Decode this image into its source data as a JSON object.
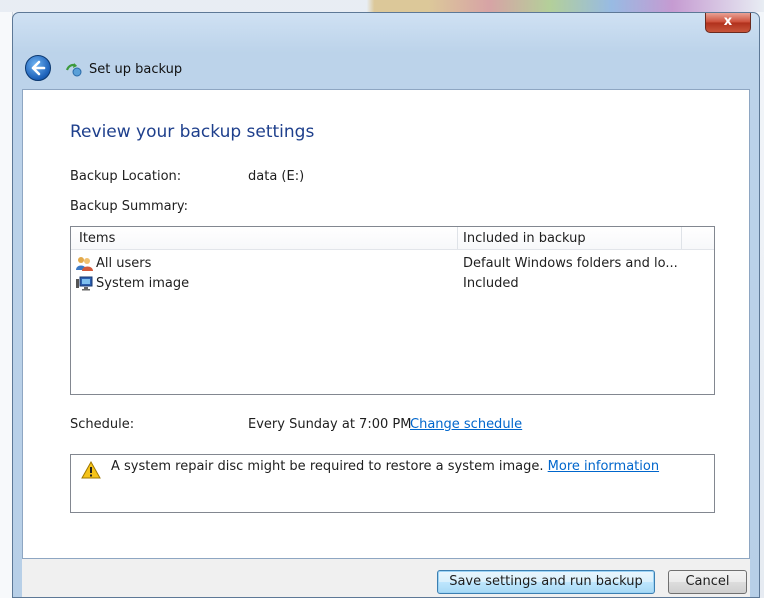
{
  "window": {
    "title": "Set up backup",
    "close_glyph": "x"
  },
  "page": {
    "heading": "Review your backup settings"
  },
  "summary": {
    "location_label": "Backup Location:",
    "location_value": "data (E:)",
    "summary_label": "Backup Summary:"
  },
  "table": {
    "columns": [
      "Items",
      "Included in backup"
    ],
    "rows": [
      {
        "item": "All users",
        "included": "Default Windows folders and lo...",
        "icon": "users-icon"
      },
      {
        "item": "System image",
        "included": "Included",
        "icon": "system-image-icon"
      }
    ]
  },
  "schedule": {
    "label": "Schedule:",
    "value": "Every Sunday at 7:00 PM",
    "change_link": "Change schedule"
  },
  "warning": {
    "text": "A system repair disc might be required to restore a system image.",
    "link": "More information",
    "icon": "warning-icon"
  },
  "buttons": {
    "save": "Save settings and run backup",
    "cancel": "Cancel"
  },
  "colors": {
    "heading": "#1e3f8c",
    "link": "#0066cc",
    "close": "#c8442c"
  }
}
